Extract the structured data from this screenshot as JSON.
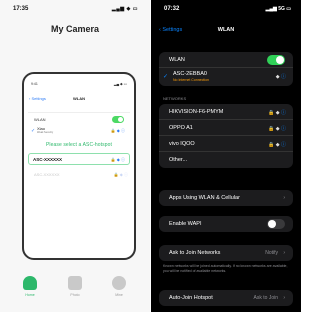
{
  "left": {
    "status": {
      "time": "17:35",
      "icons": "▂▄▆ ◆ ▭"
    },
    "title": "My Camera",
    "inner_phone": {
      "status_time": "9:41",
      "status_icons": "▂▄ ◆ ▭",
      "back_label": "‹ Settings",
      "nav_title": "WLAN",
      "wlan_label": "WLAN",
      "connected_name": "Xiao",
      "connected_sub": "Weak Security",
      "hint": "Please select a ASC-hotspot",
      "highlight_network": "ASC-XXXXXX",
      "faint_network": "ASC-XXXXXX",
      "row_symbols": "🔒 ◆ ⓘ"
    },
    "tabs": [
      {
        "label": "Home"
      },
      {
        "label": "Photo"
      },
      {
        "label": "Mine"
      }
    ]
  },
  "right": {
    "status": {
      "time": "07:32",
      "icons": "▂▄▆ 5G ▭"
    },
    "back_label": "‹ Settings",
    "title": "WLAN",
    "wlan_label": "WLAN",
    "connected": {
      "name": "ASC-2EBBA0",
      "sub": "No Internet Connection"
    },
    "connected_symbols": "◆",
    "info_symbol": "ⓘ",
    "networks_header": "NETWORKS",
    "networks": [
      {
        "name": "HIKVISION-F6-PMYM",
        "symbols": "🔒 ◆"
      },
      {
        "name": "OPPO A1",
        "symbols": "🔒 ◆"
      },
      {
        "name": "vivo IQOO",
        "symbols": "🔒 ◆"
      },
      {
        "name": "Other..."
      }
    ],
    "apps_using": "Apps Using WLAN & Cellular",
    "enable_wapi": "Enable WAPI",
    "ask_to_join": "Ask to Join Networks",
    "ask_to_join_value": "Notify",
    "ask_note": "Known networks will be joined automatically. If no known networks are available, you will be notified of available networks.",
    "auto_join_hotspot": "Auto-Join Hotspot",
    "auto_join_value": "Ask to Join",
    "chevron": "›"
  },
  "colors": {
    "accent_green": "#2db86b",
    "ios_blue": "#0a84ff",
    "toggle_green": "#30d158"
  }
}
